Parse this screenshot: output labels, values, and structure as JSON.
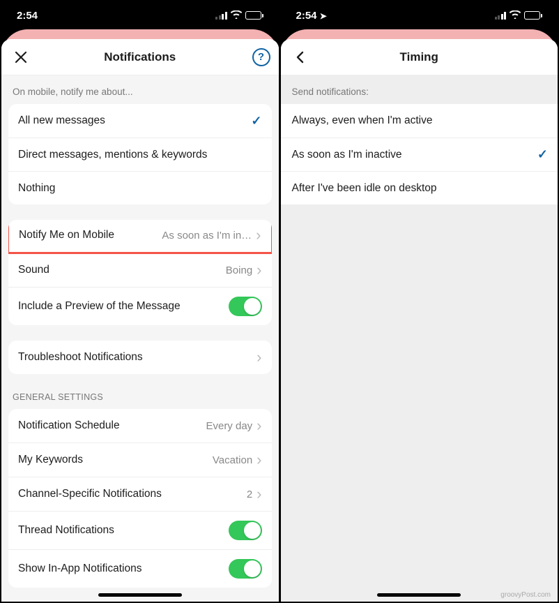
{
  "left": {
    "status_time": "2:54",
    "header_title": "Notifications",
    "help_label": "?",
    "section1_label": "On mobile, notify me about...",
    "notify_options": [
      {
        "label": "All new messages",
        "selected": true
      },
      {
        "label": "Direct messages, mentions & keywords",
        "selected": false
      },
      {
        "label": "Nothing",
        "selected": false
      }
    ],
    "settings_group1": [
      {
        "label": "Notify Me on Mobile",
        "value": "As soon as I'm in…",
        "chevron": true,
        "highlight": true
      },
      {
        "label": "Sound",
        "value": "Boing",
        "chevron": true
      },
      {
        "label": "Include a Preview of the Message",
        "toggle": true
      }
    ],
    "troubleshoot_label": "Troubleshoot Notifications",
    "general_label": "General Settings",
    "general": [
      {
        "label": "Notification Schedule",
        "value": "Every day",
        "chevron": true
      },
      {
        "label": "My Keywords",
        "value": "Vacation",
        "chevron": true
      },
      {
        "label": "Channel-Specific Notifications",
        "value": "2",
        "chevron": true
      },
      {
        "label": "Thread Notifications",
        "toggle": true
      },
      {
        "label": "Show In-App Notifications",
        "toggle": true
      }
    ]
  },
  "right": {
    "status_time": "2:54",
    "header_title": "Timing",
    "section_label": "Send notifications:",
    "options": [
      {
        "label": "Always, even when I'm active",
        "selected": false
      },
      {
        "label": "As soon as I'm inactive",
        "selected": true
      },
      {
        "label": "After I've been idle on desktop",
        "selected": false
      }
    ]
  },
  "watermark": "groovyPost.com"
}
